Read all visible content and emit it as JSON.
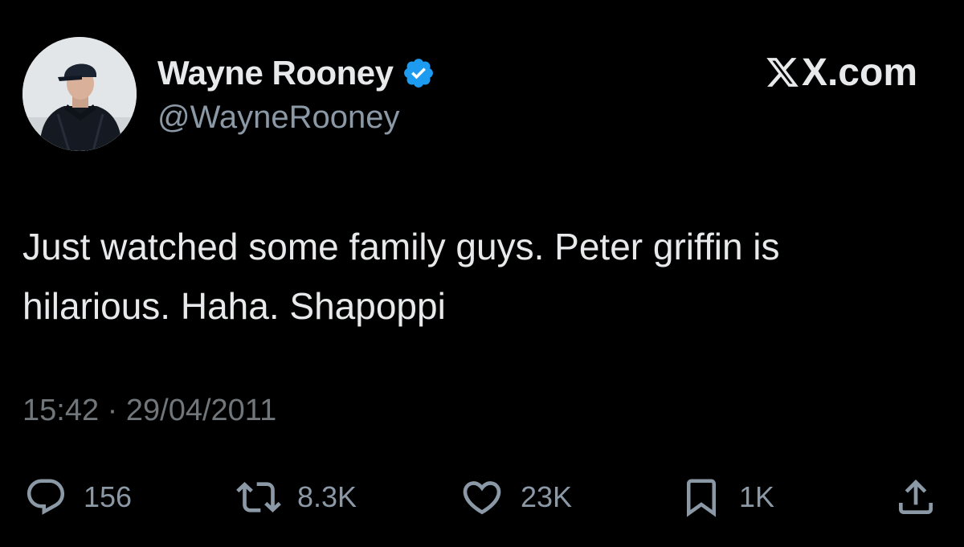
{
  "author": {
    "display_name": "Wayne Rooney",
    "handle": "@WayneRooney",
    "verified": true
  },
  "brand": {
    "label": "X.com"
  },
  "tweet": {
    "text_line1": "Just watched some family guys. Peter griffin is",
    "text_line2": "hilarious. Haha. Shapoppi",
    "timestamp": "15:42 · 29/04/2011"
  },
  "actions": {
    "reply": {
      "icon": "reply-icon",
      "count": "156"
    },
    "retweet": {
      "icon": "retweet-icon",
      "count": "8.3K"
    },
    "like": {
      "icon": "heart-icon",
      "count": "23K"
    },
    "bookmark": {
      "icon": "bookmark-icon",
      "count": "1K"
    },
    "share": {
      "icon": "share-icon"
    }
  },
  "colors": {
    "background": "#000000",
    "text_primary": "#e7e9ea",
    "text_secondary": "#8b98a5",
    "timestamp": "#71767b",
    "verified_blue": "#1d9bf0"
  }
}
